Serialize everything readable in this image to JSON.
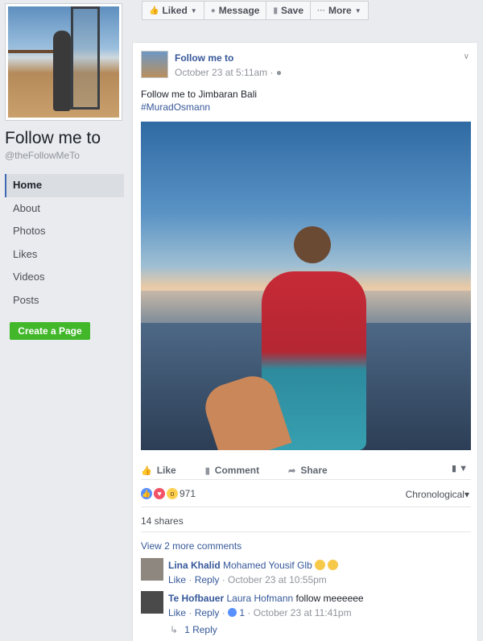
{
  "sidebar": {
    "page_title": "Follow me to",
    "page_handle": "@theFollowMeTo",
    "nav": [
      "Home",
      "About",
      "Photos",
      "Likes",
      "Videos",
      "Posts"
    ],
    "active_nav": "Home",
    "create_page": "Create a Page"
  },
  "actionbar": {
    "liked": "Liked",
    "message": "Message",
    "save": "Save",
    "more": "More"
  },
  "post": {
    "author": "Follow me to",
    "time": "October 23 at 5:11am",
    "text": "Follow me to Jimbaran Bali",
    "hashtag": "#MuradOsmann",
    "actions": {
      "like": "Like",
      "comment": "Comment",
      "share": "Share"
    },
    "reaction_count": "971",
    "order": "Chronological",
    "shares": "14 shares",
    "more_comments": "View 2 more comments"
  },
  "comments": [
    {
      "name": "Lina Khalid",
      "tag": "Mohamed Yousif Glb",
      "text": "",
      "like": "Like",
      "reply": "Reply",
      "likes": "",
      "time": "October 23 at 10:55pm"
    },
    {
      "name": "Te Hofbauer",
      "tag": "Laura Hofmann",
      "text": "follow meeeeee",
      "like": "Like",
      "reply": "Reply",
      "likes": "1",
      "time": "October 23 at 11:41pm"
    }
  ],
  "replies": "1 Reply",
  "colors": {
    "link": "#365899",
    "accent": "#4267b2",
    "create_button": "#42b72a"
  }
}
